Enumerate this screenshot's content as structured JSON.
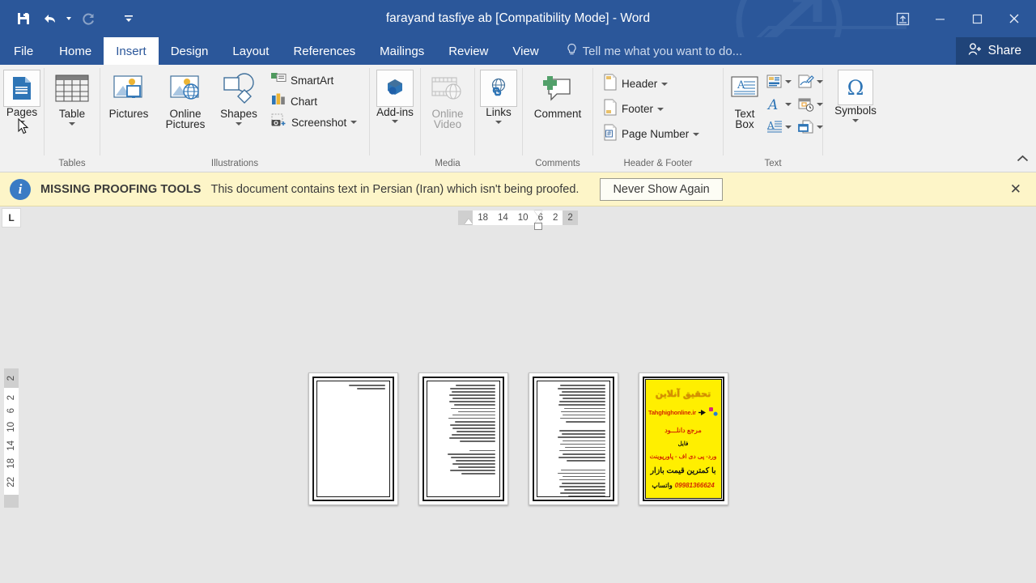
{
  "window": {
    "title": "farayand tasfiye ab [Compatibility Mode] - Word",
    "accent_color": "#2b579a",
    "quick_access": [
      {
        "name": "save-icon",
        "label": "Save"
      },
      {
        "name": "undo-icon",
        "label": "Undo"
      },
      {
        "name": "redo-icon",
        "label": "Redo"
      },
      {
        "name": "customize-qat-icon",
        "label": "Customize Quick Access Toolbar"
      }
    ],
    "controls": [
      {
        "name": "ribbon-display-options-icon",
        "label": "Ribbon Display Options"
      },
      {
        "name": "minimize-icon",
        "label": "Minimize",
        "glyph": "─"
      },
      {
        "name": "restore-icon",
        "label": "Restore Down",
        "glyph": "❐"
      },
      {
        "name": "close-icon",
        "label": "Close",
        "glyph": "✕"
      }
    ]
  },
  "tabs": {
    "items": [
      {
        "label": "File",
        "active": false
      },
      {
        "label": "Home",
        "active": false
      },
      {
        "label": "Insert",
        "active": true
      },
      {
        "label": "Design",
        "active": false
      },
      {
        "label": "Layout",
        "active": false
      },
      {
        "label": "References",
        "active": false
      },
      {
        "label": "Mailings",
        "active": false
      },
      {
        "label": "Review",
        "active": false
      },
      {
        "label": "View",
        "active": false
      }
    ],
    "tell_me": "Tell me what you want to do...",
    "share": "Share"
  },
  "ribbon": {
    "groups": [
      {
        "label": "Pages",
        "show_label": false,
        "buttons": [
          {
            "label": "Pages",
            "icon": "pages-icon",
            "has_arrow": true,
            "highlighted": true
          }
        ]
      },
      {
        "label": "Tables",
        "buttons": [
          {
            "label": "Table",
            "icon": "table-icon",
            "has_arrow": true
          }
        ]
      },
      {
        "label": "Illustrations",
        "buttons": [
          {
            "label": "Pictures",
            "icon": "pictures-icon",
            "has_arrow": false
          },
          {
            "label": "Online Pictures",
            "icon": "online-pictures-icon",
            "has_arrow": false
          },
          {
            "label": "Shapes",
            "icon": "shapes-icon",
            "has_arrow": true
          }
        ],
        "small_items": [
          {
            "label": "SmartArt",
            "icon": "smartart-icon",
            "has_arrow": false
          },
          {
            "label": "Chart",
            "icon": "chart-icon",
            "has_arrow": false
          },
          {
            "label": "Screenshot",
            "icon": "screenshot-icon",
            "has_arrow": true
          }
        ]
      },
      {
        "label": "",
        "buttons": [
          {
            "label": "Add-ins",
            "icon": "addins-icon",
            "has_arrow": true,
            "highlighted": true
          }
        ]
      },
      {
        "label": "Media",
        "buttons": [
          {
            "label": "Online Video",
            "icon": "online-video-icon",
            "has_arrow": false,
            "disabled": true
          }
        ]
      },
      {
        "label": "",
        "buttons": [
          {
            "label": "Links",
            "icon": "links-icon",
            "has_arrow": true,
            "highlighted": true
          }
        ]
      },
      {
        "label": "Comments",
        "buttons": [
          {
            "label": "Comment",
            "icon": "comment-icon",
            "has_arrow": false
          }
        ]
      },
      {
        "label": "Header & Footer",
        "small_items": [
          {
            "label": "Header",
            "icon": "header-icon",
            "has_arrow": true
          },
          {
            "label": "Footer",
            "icon": "footer-icon",
            "has_arrow": true
          },
          {
            "label": "Page Number",
            "icon": "page-number-icon",
            "has_arrow": true
          }
        ]
      },
      {
        "label": "Text",
        "buttons": [
          {
            "label": "Text Box",
            "icon": "text-box-icon",
            "has_arrow": true
          }
        ],
        "icon_grid": [
          [
            "quick-parts-icon",
            "signature-line-icon"
          ],
          [
            "wordart-icon",
            "date-time-icon"
          ],
          [
            "drop-cap-icon",
            "object-icon"
          ]
        ]
      },
      {
        "label": "Symbols",
        "buttons": [
          {
            "label": "Symbols",
            "icon": "symbols-icon",
            "glyph": "Ω",
            "has_arrow": true,
            "highlighted": true
          }
        ]
      }
    ],
    "collapse_label": "Collapse the Ribbon"
  },
  "notification": {
    "title": "MISSING PROOFING TOOLS",
    "message": "This document contains text in Persian (Iran) which isn't being proofed.",
    "button": "Never Show Again",
    "close_glyph": "✕",
    "info_glyph": "i",
    "background": "#fdf5c8"
  },
  "rulers": {
    "corner_tab_stop": "L",
    "horizontal_numbers": [
      "18",
      "14",
      "10",
      "6",
      "2",
      "2"
    ],
    "vertical_numbers": [
      "2",
      "2",
      "6",
      "10",
      "14",
      "18",
      "22"
    ]
  },
  "document": {
    "pages": [
      {
        "name": "page-thumbnail-1",
        "type": "text",
        "paragraphs": [
          [
            56,
            44
          ],
          []
        ]
      },
      {
        "name": "page-thumbnail-2",
        "type": "text",
        "paragraphs": [
          [
            62,
            70,
            68,
            72,
            66,
            71,
            64,
            69,
            58,
            67,
            73,
            63,
            70,
            66,
            60,
            68,
            71,
            55
          ],
          [
            40,
            74,
            69,
            62,
            66,
            58,
            70,
            52
          ]
        ]
      },
      {
        "name": "page-thumbnail-3",
        "type": "text",
        "paragraphs": [
          [
            70,
            74,
            68,
            72,
            66,
            71,
            73,
            64,
            69,
            67,
            70,
            62
          ],
          [
            72,
            68,
            74,
            66,
            70,
            63,
            71,
            67,
            73,
            60
          ],
          [
            69,
            74,
            66,
            71,
            68,
            72,
            64,
            70,
            58
          ]
        ]
      },
      {
        "name": "page-thumbnail-4",
        "type": "advertisement",
        "ad": {
          "brand": "تحقیق آنلاین",
          "url": "Tahghighonline.ir",
          "line1": "مرجع دانلـــود",
          "line2": "فایل",
          "line3": "ورد- پی دی اف - پاورپوینت",
          "line4": "با کمترین قیمت بازار",
          "phone": "09981366624",
          "whatsapp": "واتساپ",
          "background": "#ffef00"
        }
      }
    ]
  }
}
